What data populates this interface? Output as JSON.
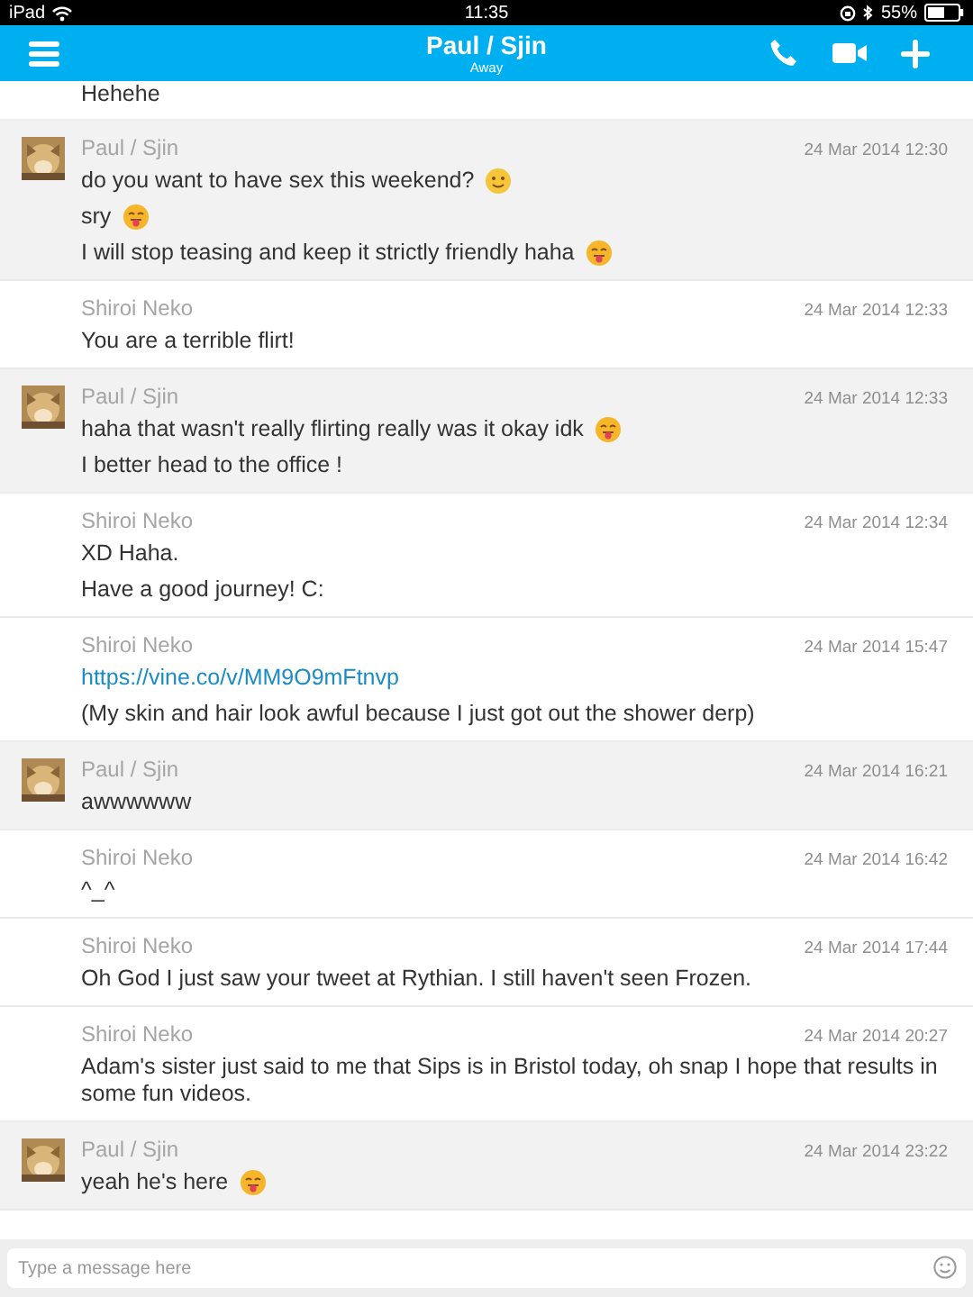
{
  "status_bar": {
    "device": "iPad",
    "time": "11:35",
    "battery": "55%"
  },
  "header": {
    "title": "Paul / Sjin",
    "status": "Away"
  },
  "messages": [
    {
      "kind": "continuation",
      "lines": [
        {
          "text": "Hehehe"
        }
      ]
    },
    {
      "kind": "incoming",
      "sender": "Paul / Sjin",
      "time": "24 Mar 2014 12:30",
      "lines": [
        {
          "kind": "smile",
          "text": "do you want to have sex this weekend?"
        },
        {
          "kind": "tongue",
          "text": "sry"
        },
        {
          "kind": "tongue",
          "text": "I will stop teasing and keep it strictly friendly haha"
        }
      ]
    },
    {
      "kind": "outgoing",
      "sender": "Shiroi Neko",
      "time": "24 Mar 2014 12:33",
      "lines": [
        {
          "kind": "plain",
          "text": "You are a terrible flirt!"
        }
      ]
    },
    {
      "kind": "incoming",
      "sender": "Paul / Sjin",
      "time": "24 Mar 2014 12:33",
      "lines": [
        {
          "kind": "tongue",
          "text": "haha that wasn't really flirting really was it okay idk"
        },
        {
          "kind": "plain",
          "text": "I better head to the office !"
        }
      ]
    },
    {
      "kind": "outgoing",
      "sender": "Shiroi Neko",
      "time": "24 Mar 2014 12:34",
      "lines": [
        {
          "kind": "plain",
          "text": "XD Haha."
        },
        {
          "kind": "plain",
          "text": "Have a good journey! C:"
        }
      ]
    },
    {
      "kind": "outgoing",
      "sender": "Shiroi Neko",
      "time": "24 Mar 2014 15:47",
      "lines": [
        {
          "kind": "link",
          "text": "https://vine.co/v/MM9O9mFtnvp"
        },
        {
          "kind": "plain",
          "text": "(My skin and hair look awful because I just got out the shower derp)"
        }
      ]
    },
    {
      "kind": "incoming",
      "sender": "Paul / Sjin",
      "time": "24 Mar 2014 16:21",
      "lines": [
        {
          "kind": "plain",
          "text": "awwwwww"
        }
      ]
    },
    {
      "kind": "outgoing",
      "sender": "Shiroi Neko",
      "time": "24 Mar 2014 16:42",
      "lines": [
        {
          "kind": "plain",
          "text": "^_^"
        }
      ]
    },
    {
      "kind": "outgoing",
      "sender": "Shiroi Neko",
      "time": "24 Mar 2014 17:44",
      "lines": [
        {
          "kind": "plain",
          "text": "Oh God I just saw your tweet at Rythian. I still haven't seen Frozen."
        }
      ]
    },
    {
      "kind": "outgoing",
      "sender": "Shiroi Neko",
      "time": "24 Mar 2014 20:27",
      "lines": [
        {
          "kind": "plain",
          "text": "Adam's sister just said to me that Sips is in Bristol today, oh snap I hope that results in some fun videos."
        }
      ]
    },
    {
      "kind": "incoming",
      "sender": "Paul / Sjin",
      "time": "24 Mar 2014 23:22",
      "lines": [
        {
          "kind": "tongue",
          "text": "yeah he's here"
        }
      ]
    }
  ],
  "composer": {
    "placeholder": "Type a message here"
  }
}
